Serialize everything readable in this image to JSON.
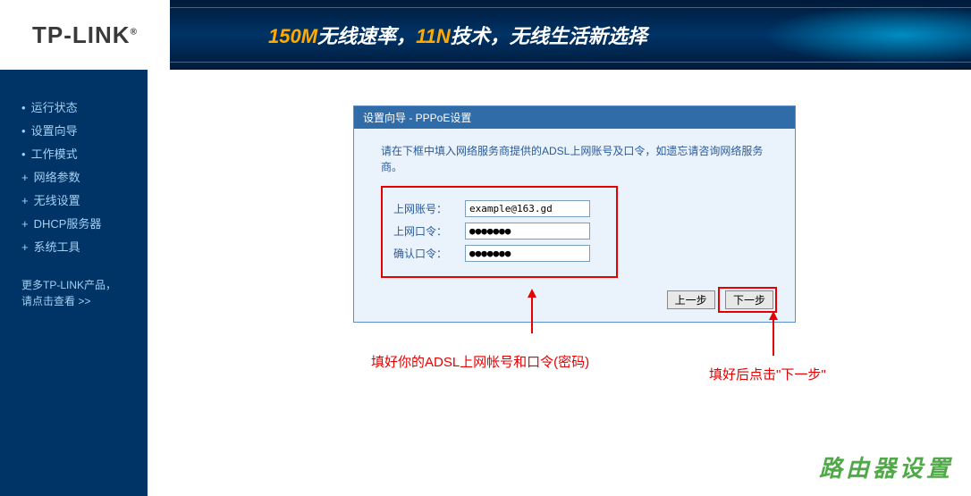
{
  "header": {
    "logo": "TP-LINK",
    "logo_reg": "®",
    "banner_parts": {
      "p1": "150M",
      "p2": "无线速率，",
      "p3": "11N",
      "p4": "技术，无线生活新选择"
    }
  },
  "sidebar": {
    "items": [
      {
        "label": "运行状态",
        "type": "bullet"
      },
      {
        "label": "设置向导",
        "type": "bullet"
      },
      {
        "label": "工作模式",
        "type": "bullet"
      },
      {
        "label": "网络参数",
        "type": "plus"
      },
      {
        "label": "无线设置",
        "type": "plus"
      },
      {
        "label": "DHCP服务器",
        "type": "plus"
      },
      {
        "label": "系统工具",
        "type": "plus"
      }
    ],
    "more_line1": "更多TP-LINK产品，",
    "more_line2": "请点击查看 >>"
  },
  "wizard": {
    "title": "设置向导 - PPPoE设置",
    "instruction": "请在下框中填入网络服务商提供的ADSL上网账号及口令，如遗忘请咨询网络服务商。",
    "fields": {
      "account_label": "上网账号：",
      "account_value": "example@163.gd",
      "password_label": "上网口令：",
      "password_value": "●●●●●●●",
      "confirm_label": "确认口令：",
      "confirm_value": "●●●●●●●"
    },
    "buttons": {
      "prev": "上一步",
      "next": "下一步"
    }
  },
  "annotations": {
    "form_note": "填好你的ADSL上网帐号和口令(密码)",
    "next_note": "填好后点击\"下一步\""
  },
  "footer_bg": "路由器设置"
}
